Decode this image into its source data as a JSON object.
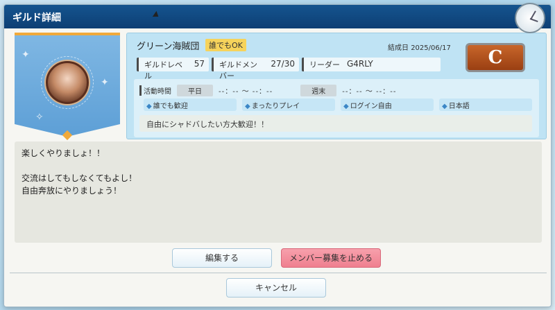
{
  "window": {
    "title": "ギルド詳細"
  },
  "guild": {
    "name": "グリーン海賊団",
    "join_policy_badge": "誰でもOK",
    "founded_label": "結成日",
    "founded_date": "2025/06/17",
    "rank": "C",
    "level_label": "ギルドレベル",
    "level_value": "57",
    "members_label": "ギルドメンバー",
    "members_value": "27/30",
    "leader_label": "リーダー",
    "leader_value": "G4RLY"
  },
  "activity": {
    "label": "活動時間",
    "weekday_label": "平日",
    "weekday_time": "--：-- 〜 --：--",
    "weekend_label": "週末",
    "weekend_time": "--：-- 〜 --：--",
    "tags": [
      "誰でも歓迎",
      "まったりプレイ",
      "ログイン自由",
      "日本語"
    ],
    "motto": "自由にシャドバしたい方大歓迎！！"
  },
  "message": {
    "lines": [
      "楽しくやりましょ！！",
      "",
      "交流はしてもしなくてもよし！",
      "自由奔放にやりましょう！"
    ]
  },
  "buttons": {
    "edit": "編集する",
    "stop_recruit": "メンバー募集を止める",
    "cancel": "キャンセル"
  },
  "icons": {
    "tag": "tag-icon",
    "clock": "clock-icon",
    "cursor": "cursor-icon"
  }
}
